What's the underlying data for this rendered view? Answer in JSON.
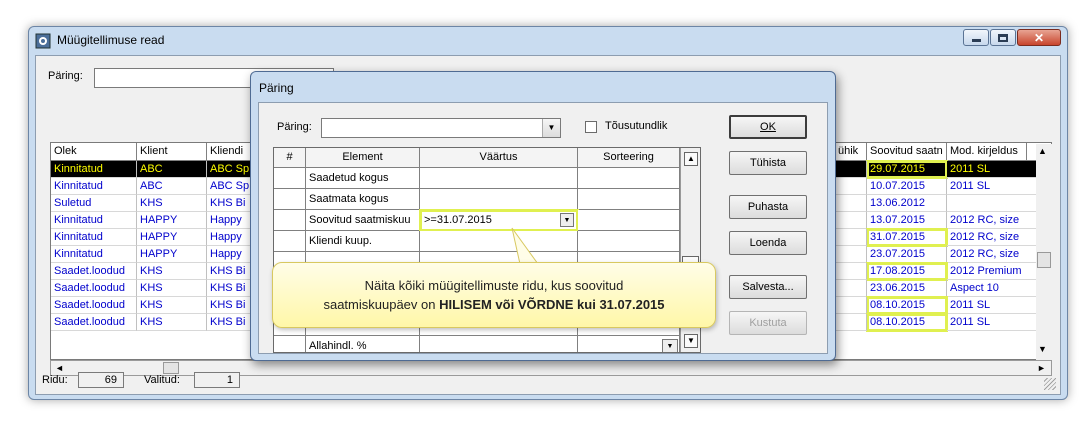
{
  "window": {
    "title": "Müügitellimuse read"
  },
  "filter": {
    "label": "Päring:",
    "value": ""
  },
  "grid": {
    "columns": [
      "Olek",
      "Klient",
      "Kliendi",
      "ühik",
      "Soovitud saatn",
      "Mod. kirjeldus"
    ],
    "rows": [
      {
        "olek": "Kinnitatud",
        "klient": "ABC",
        "kliendi": "ABC Sp",
        "date": "29.07.2015",
        "mod": "2011 SL",
        "selected": true
      },
      {
        "olek": "Kinnitatud",
        "klient": "ABC",
        "kliendi": "ABC Sp",
        "date": "10.07.2015",
        "mod": "2011 SL"
      },
      {
        "olek": "Suletud",
        "klient": "KHS",
        "kliendi": "KHS Bi",
        "date": "13.06.2012",
        "mod": ""
      },
      {
        "olek": "Kinnitatud",
        "klient": "HAPPY",
        "kliendi": "Happy",
        "date": "13.07.2015",
        "mod": "2012 RC, size"
      },
      {
        "olek": "Kinnitatud",
        "klient": "HAPPY",
        "kliendi": "Happy",
        "date": "31.07.2015",
        "mod": "2012 RC, size",
        "hl": true
      },
      {
        "olek": "Kinnitatud",
        "klient": "HAPPY",
        "kliendi": "Happy",
        "date": "23.07.2015",
        "mod": "2012 RC, size"
      },
      {
        "olek": "Saadet.loodud",
        "klient": "KHS",
        "kliendi": "KHS Bi",
        "date": "17.08.2015",
        "mod": "2012 Premium",
        "hl": true
      },
      {
        "olek": "Saadet.loodud",
        "klient": "KHS",
        "kliendi": "KHS Bi",
        "date": "23.06.2015",
        "mod": "Aspect 10"
      },
      {
        "olek": "Saadet.loodud",
        "klient": "KHS",
        "kliendi": "KHS Bi",
        "date": "08.10.2015",
        "mod": "2011 SL",
        "hl": true
      },
      {
        "olek": "Saadet.loodud",
        "klient": "KHS",
        "kliendi": "KHS Bi",
        "date": "08.10.2015",
        "mod": "2011 SL",
        "hl": true
      }
    ]
  },
  "status": {
    "rows_label": "Ridu:",
    "rows_value": "69",
    "selected_label": "Valitud:",
    "selected_value": "1"
  },
  "dialog": {
    "title": "Päring",
    "query_label": "Päring:",
    "query_value": "",
    "ascending_label": "Tõusutundlik",
    "columns": [
      "#",
      "Element",
      "Väärtus",
      "Sorteering"
    ],
    "rows": [
      {
        "element": "Saadetud kogus",
        "value": ""
      },
      {
        "element": "Saatmata kogus",
        "value": ""
      },
      {
        "element": "Soovitud saatmiskuu",
        "value": ">=31.07.2015",
        "active": true
      },
      {
        "element": "Kliendi kuup.",
        "value": ""
      },
      {
        "element": "",
        "value": ""
      },
      {
        "element": "",
        "value": ""
      },
      {
        "element": "",
        "value": ""
      },
      {
        "element": "",
        "value": ""
      },
      {
        "element": "Allahindl. %",
        "value": ""
      }
    ],
    "buttons": {
      "ok": "OK",
      "cancel": "Tühista",
      "clear": "Puhasta",
      "read": "Loenda",
      "save": "Salvesta...",
      "delete": "Kustuta"
    }
  },
  "callout": {
    "line1": "Näita kõiki müügitellimuste ridu, kus soovitud",
    "line2_prefix": "saatmiskuupäev on ",
    "line2_bold": "HILISEM või VÕRDNE kui 31.07.2015"
  },
  "colors": {
    "highlight": "#e0f050",
    "link_blue": "#0000cc",
    "selected_text": "#ffff00"
  }
}
